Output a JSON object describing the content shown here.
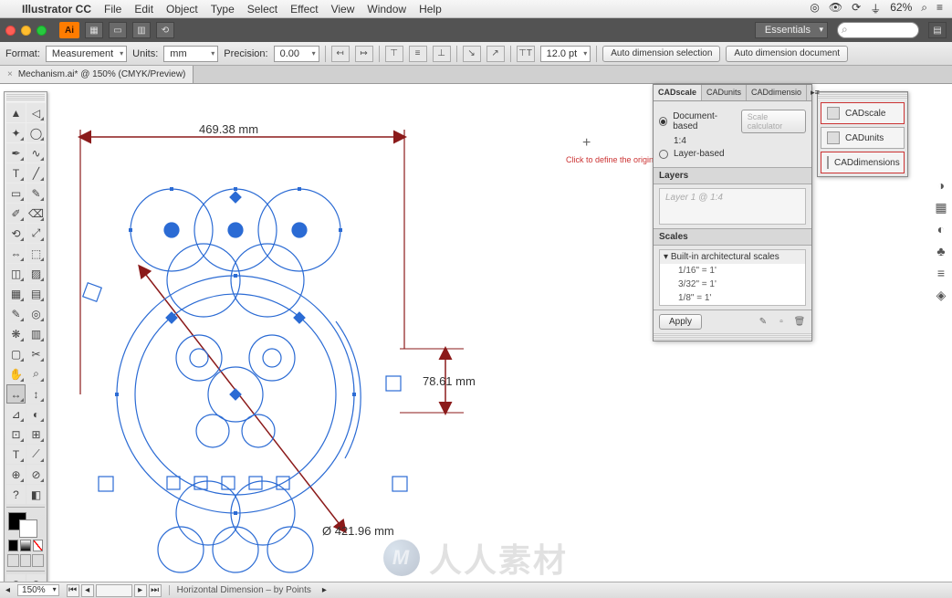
{
  "mac_menu": {
    "app": "Illustrator CC",
    "items": [
      "File",
      "Edit",
      "Object",
      "Type",
      "Select",
      "Effect",
      "View",
      "Window",
      "Help"
    ],
    "battery": "62%"
  },
  "app_bar": {
    "badge": "Ai",
    "workspace": "Essentials"
  },
  "ctrl_bar": {
    "format_label": "Format:",
    "format_value": "Measurement",
    "units_label": "Units:",
    "units_value": "mm",
    "precision_label": "Precision:",
    "precision_value": "0.00",
    "font_size": "12.0 pt",
    "auto_sel": "Auto dimension selection",
    "auto_doc": "Auto dimension document"
  },
  "tab": {
    "name": "Mechanism.ai* @ 150% (CMYK/Preview)"
  },
  "canvas": {
    "dim_top": "469.38 mm",
    "dim_right": "78.61 mm",
    "dim_diag": "Ø 421.96 mm",
    "hint": "Click to define the origin of the"
  },
  "cad_buttons": {
    "b1": "CADscale",
    "b2": "CADunits",
    "b3": "CADdimensions"
  },
  "cad_panel": {
    "tab1": "CADscale",
    "tab2": "CADunits",
    "tab3": "CADdimensio",
    "doc_based": "Document-based",
    "ratio": "1:4",
    "layer_based": "Layer-based",
    "calc": "Scale calculator",
    "layers_head": "Layers",
    "layers_placeholder": "Layer 1 @ 1:4",
    "scales_head": "Scales",
    "scales_group": "Built-in architectural scales",
    "s1": "1/16\" = 1'",
    "s2": "3/32\" = 1'",
    "s3": "1/8\" = 1'",
    "apply": "Apply"
  },
  "status": {
    "zoom": "150%",
    "info": "Horizontal Dimension – by Points"
  },
  "watermark": "人人素材"
}
